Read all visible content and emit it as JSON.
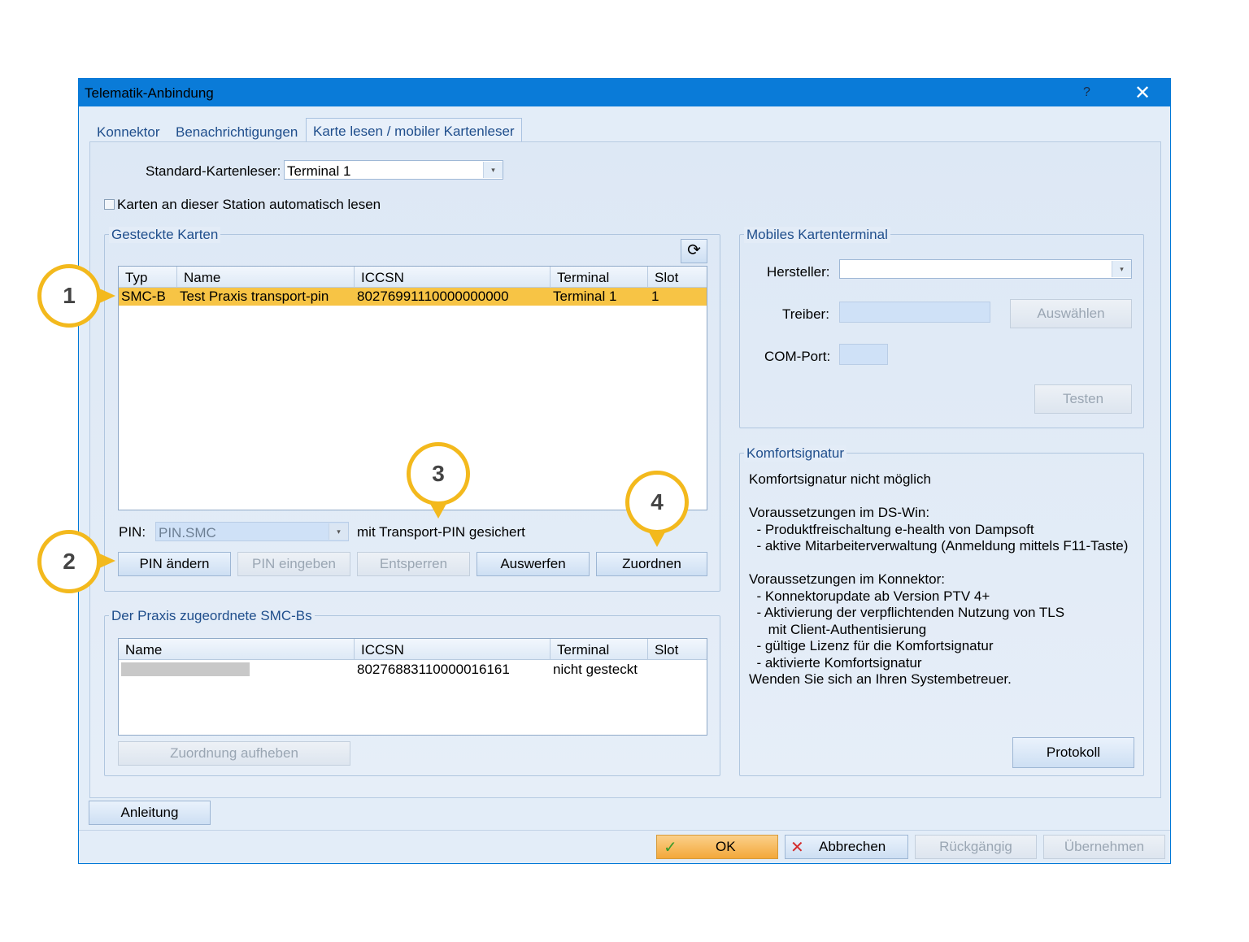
{
  "window": {
    "title": "Telematik-Anbindung",
    "help_glyph": "?",
    "close_glyph": "✕"
  },
  "tabs": [
    {
      "label": "Konnektor"
    },
    {
      "label": "Benachrichtigungen"
    },
    {
      "label": "Karte lesen / mobiler Kartenleser"
    }
  ],
  "card_reader": {
    "label": "Standard-Kartenleser:",
    "value": "Terminal 1",
    "auto_read_label": "Karten an dieser Station automatisch lesen"
  },
  "inserted_cards": {
    "title": "Gesteckte Karten",
    "refresh_icon": "refresh-icon",
    "columns": [
      "Typ",
      "Name",
      "ICCSN",
      "Terminal",
      "Slot"
    ],
    "rows": [
      {
        "typ": "SMC-B",
        "name": "Test Praxis transport-pin",
        "iccsn": "80276991110000000000",
        "terminal": "Terminal 1",
        "slot": "1"
      }
    ],
    "pin_label": "PIN:",
    "pin_value": "PIN.SMC",
    "pin_status": "mit Transport-PIN gesichert",
    "buttons": {
      "change_pin": "PIN ändern",
      "enter_pin": "PIN eingeben",
      "unlock": "Entsperren",
      "eject": "Auswerfen",
      "assign": "Zuordnen"
    }
  },
  "assigned_smcb": {
    "title": "Der Praxis zugeordnete SMC-Bs",
    "columns": [
      "Name",
      "ICCSN",
      "Terminal",
      "Slot"
    ],
    "rows": [
      {
        "name": "",
        "iccsn": "80276883110000016161",
        "terminal": "nicht gesteckt",
        "slot": ""
      }
    ],
    "unassign_button": "Zuordnung aufheben"
  },
  "mobile_terminal": {
    "title": "Mobiles Kartenterminal",
    "manufacturer_label": "Hersteller:",
    "driver_label": "Treiber:",
    "select_button": "Auswählen",
    "com_port_label": "COM-Port:",
    "test_button": "Testen"
  },
  "comfort_signature": {
    "title": "Komfortsignatur",
    "lines": [
      "Komfortsignatur nicht möglich",
      "",
      "Voraussetzungen im DS-Win:",
      "  - Produktfreischaltung e-health von Dampsoft",
      "  - aktive Mitarbeiterverwaltung (Anmeldung mittels F11-Taste)",
      "",
      "Voraussetzungen im Konnektor:",
      "  - Konnektorupdate ab Version PTV 4+",
      "  - Aktivierung der verpflichtenden Nutzung von TLS",
      "     mit Client-Authentisierung",
      "  - gültige Lizenz für die Komfortsignatur",
      "  - aktivierte Komfortsignatur",
      "Wenden Sie sich an Ihren Systembetreuer."
    ],
    "protocol_button": "Protokoll"
  },
  "footer": {
    "manual_button": "Anleitung",
    "ok_button": "OK",
    "cancel_button": "Abbrechen",
    "undo_button": "Rückgängig",
    "apply_button": "Übernehmen"
  },
  "callouts": [
    "1",
    "2",
    "3",
    "4"
  ],
  "colors": {
    "titlebar": "#0a7bd8",
    "selection": "#f7c445",
    "callout": "#f3b91d",
    "ok_button": "#f6b44a"
  }
}
